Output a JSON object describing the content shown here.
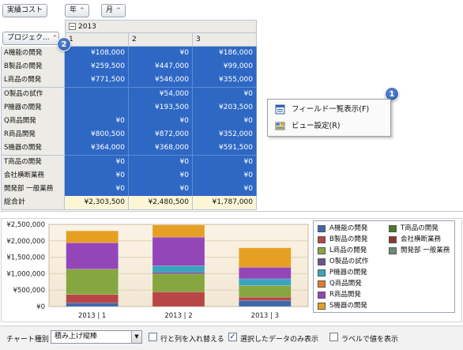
{
  "pivot": {
    "filter_fields": [
      {
        "label": "実績コスト"
      }
    ],
    "column_fields": [
      {
        "label": "年",
        "arrow": "^"
      },
      {
        "label": "月",
        "arrow": "^"
      }
    ],
    "row_field": {
      "label": "プロジェク...",
      "arrow": "^"
    },
    "year_header": {
      "collapse_glyph": "−",
      "label": "2013"
    },
    "month_headers": [
      "1",
      "2",
      "3"
    ],
    "rows": [
      {
        "label": "A機能の開発",
        "values": [
          "¥108,000",
          "¥0",
          "¥186,000"
        ]
      },
      {
        "label": "B製品の開発",
        "values": [
          "¥259,500",
          "¥447,000",
          "¥99,000"
        ]
      },
      {
        "label": "L商品の開発",
        "values": [
          "¥771,500",
          "¥546,000",
          "¥355,000"
        ]
      },
      {
        "label": "O製品の試作",
        "values": [
          "",
          "¥54,000",
          "¥0"
        ]
      },
      {
        "label": "P機器の開発",
        "values": [
          "",
          "¥193,500",
          "¥203,500"
        ]
      },
      {
        "label": "Q商品開発",
        "values": [
          "¥0",
          "¥0",
          "¥0"
        ]
      },
      {
        "label": "R商品開発",
        "values": [
          "¥800,500",
          "¥872,000",
          "¥352,000"
        ]
      },
      {
        "label": "S機器の開発",
        "values": [
          "¥364,000",
          "¥368,000",
          "¥591,500"
        ]
      },
      {
        "label": "T商品の開発",
        "values": [
          "¥0",
          "¥0",
          "¥0"
        ]
      },
      {
        "label": "会社横断業務",
        "values": [
          "¥0",
          "¥0",
          "¥0"
        ]
      },
      {
        "label": "開発部 一般業務",
        "values": [
          "¥0",
          "¥0",
          "¥0"
        ]
      }
    ],
    "total_row": {
      "label": "総合計",
      "values": [
        "¥2,303,500",
        "¥2,480,500",
        "¥1,787,000"
      ]
    }
  },
  "badges": {
    "badge_1": "1",
    "badge_2": "2"
  },
  "context_menu": {
    "items": [
      {
        "label": "フィールド一覧表示(F)",
        "icon": "field-list-icon"
      },
      {
        "label": "ビュー設定(R)",
        "icon": "view-settings-icon"
      }
    ]
  },
  "chart_data": {
    "type": "bar",
    "stacked": true,
    "categories": [
      "2013 | 1",
      "2013 | 2",
      "2013 | 3"
    ],
    "ylim": [
      0,
      2500000
    ],
    "yticks": [
      "¥0",
      "¥500,000",
      "¥1,000,000",
      "¥1,500,000",
      "¥2,000,000",
      "¥2,500,000"
    ],
    "legend_position": "right",
    "series": [
      {
        "name": "A機能の開発",
        "color": "#3f68ad",
        "values": [
          108000,
          0,
          186000
        ]
      },
      {
        "name": "B製品の開発",
        "color": "#b94646",
        "values": [
          259500,
          447000,
          99000
        ]
      },
      {
        "name": "L商品の開発",
        "color": "#86a640",
        "values": [
          771500,
          546000,
          355000
        ]
      },
      {
        "name": "O製品の試作",
        "color": "#6e5196",
        "values": [
          0,
          54000,
          0
        ]
      },
      {
        "name": "P機器の開発",
        "color": "#3aa4bf",
        "values": [
          0,
          193500,
          203500
        ]
      },
      {
        "name": "Q商品開発",
        "color": "#e8792a",
        "values": [
          0,
          0,
          0
        ]
      },
      {
        "name": "R商品開発",
        "color": "#9446b8",
        "values": [
          800500,
          872000,
          352000
        ]
      },
      {
        "name": "S機器の開発",
        "color": "#e5a024",
        "values": [
          364000,
          368000,
          591500
        ]
      },
      {
        "name": "T商品の開発",
        "color": "#4a7a2e",
        "values": [
          0,
          0,
          0
        ]
      },
      {
        "name": "会社横断業務",
        "color": "#8a3a2a",
        "values": [
          0,
          0,
          0
        ]
      },
      {
        "name": "開発部 一般業務",
        "color": "#6a8a7a",
        "values": [
          0,
          0,
          0
        ]
      }
    ]
  },
  "bottom_bar": {
    "chart_type_label": "チャート種別",
    "chart_type_value": "積み上げ縦棒",
    "swap_rows_cols_label": "行と列を入れ替える",
    "swap_rows_cols_checked": false,
    "selected_only_label": "選択したデータのみ表示",
    "selected_only_checked": true,
    "show_value_labels_label": "ラベルで値を表示",
    "show_value_labels_checked": false
  }
}
